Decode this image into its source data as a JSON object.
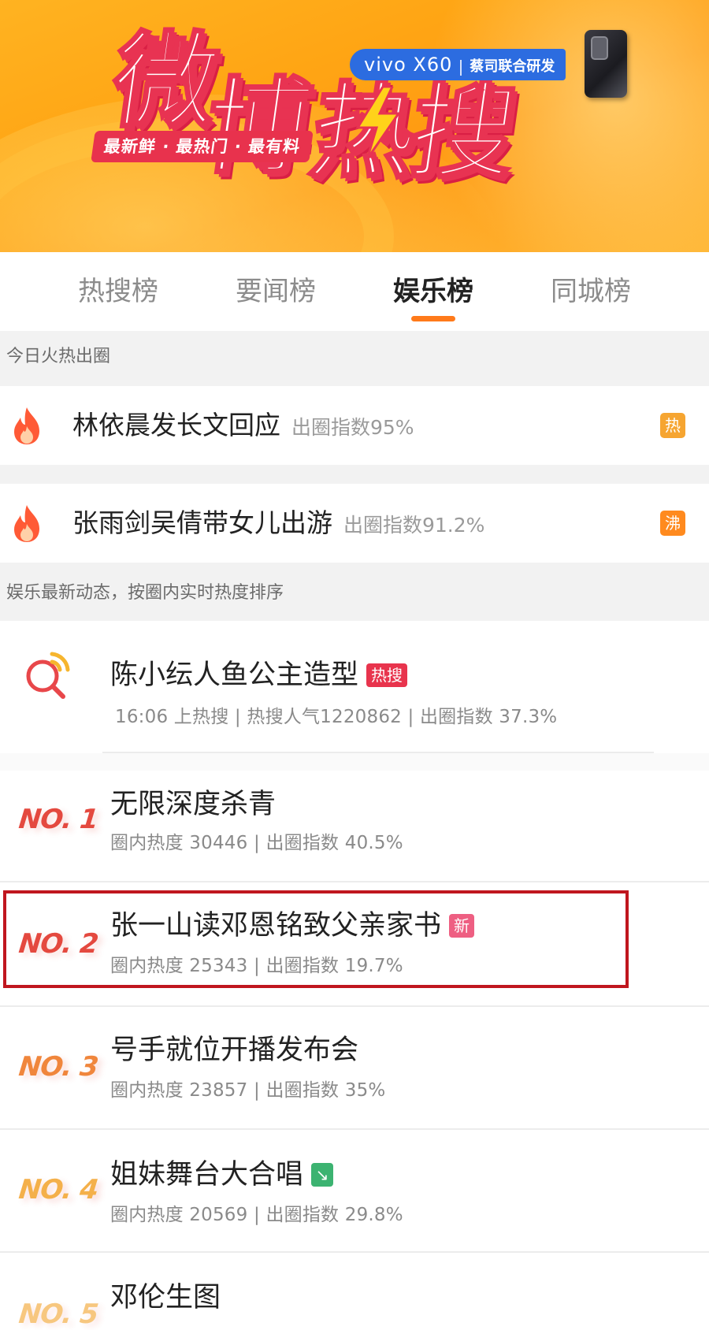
{
  "banner": {
    "title_char1": "微",
    "title_char2": "博",
    "title_char3": "热",
    "title_char4": "搜",
    "tagline": "最新鲜 · 最热门 · 最有料",
    "sponsor_brand": "vivo X60",
    "sponsor_sub": "蔡司联合研发",
    "colors": {
      "title_red": "#e83352",
      "bolt": "#ffd21a",
      "sponsor_blue": "#2c6ce0"
    }
  },
  "tabs": [
    {
      "label": "热搜榜",
      "active": false
    },
    {
      "label": "要闻榜",
      "active": false
    },
    {
      "label": "娱乐榜",
      "active": true
    },
    {
      "label": "同城榜",
      "active": false
    }
  ],
  "section_today": {
    "label": "今日火热出圈"
  },
  "hot_items": [
    {
      "title": "林依晨发长文回应",
      "index": "出圈指数95%",
      "badge": "热",
      "icon": "flame-icon"
    },
    {
      "title": "张雨剑吴倩带女儿出游",
      "index": "出圈指数91.2%",
      "badge": "沸",
      "icon": "flame-icon"
    }
  ],
  "section_ent": {
    "label": "娱乐最新动态，按圈内实时热度排序"
  },
  "ranking": [
    {
      "rank": "",
      "title": "陈小纭人鱼公主造型",
      "tag": "热搜",
      "meta": "16:06 上热搜 | 热搜人气1220862 | 出圈指数 37.3%",
      "icon": "hot-search-icon"
    },
    {
      "rank": "NO. 1",
      "title": "无限深度杀青",
      "tag": "",
      "meta": "圈内热度 30446 | 出圈指数 40.5%"
    },
    {
      "rank": "NO. 2",
      "title": "张一山读邓恩铭致父亲家书",
      "tag": "新",
      "meta": "圈内热度 25343 | 出圈指数 19.7%",
      "highlighted": true
    },
    {
      "rank": "NO. 3",
      "title": "号手就位开播发布会",
      "tag": "",
      "meta": "圈内热度 23857 | 出圈指数 35%"
    },
    {
      "rank": "NO. 4",
      "title": "姐妹舞台大合唱",
      "tag": "down-arrow",
      "meta": "圈内热度 20569 | 出圈指数 29.8%"
    },
    {
      "rank": "NO. 5",
      "title": "邓伦生图",
      "tag": "",
      "meta": ""
    }
  ],
  "accent_color": "#ff7a1a",
  "highlight_color": "#c0161e"
}
